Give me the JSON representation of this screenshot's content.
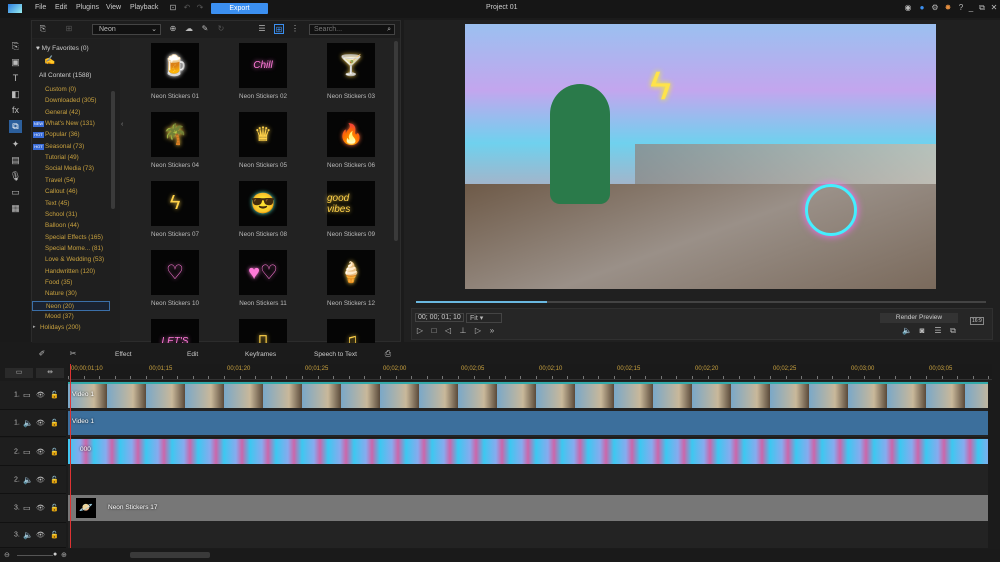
{
  "topbar": {
    "menus": [
      "File",
      "Edit",
      "Plugins",
      "View",
      "Playback"
    ],
    "export_label": "Export",
    "title": "Project 01"
  },
  "library": {
    "category_selected": "Neon",
    "search_placeholder": "Search...",
    "favorites": "My Favorites (0)",
    "all_content": "All Content (1588)",
    "categories": [
      {
        "label": "Custom  (0)"
      },
      {
        "label": "Downloaded  (305)"
      },
      {
        "label": "General  (42)"
      },
      {
        "label": "What's New  (131)",
        "badge": "NEW"
      },
      {
        "label": "Popular  (36)",
        "badge": "HOT"
      },
      {
        "label": "Seasonal  (73)",
        "badge": "HOT"
      },
      {
        "label": "Tutorial  (49)"
      },
      {
        "label": "Social Media  (73)"
      },
      {
        "label": "Travel  (54)"
      },
      {
        "label": "Callout  (46)"
      },
      {
        "label": "Text  (45)"
      },
      {
        "label": "School  (31)"
      },
      {
        "label": "Balloon  (44)"
      },
      {
        "label": "Special Effects  (165)"
      },
      {
        "label": "Special Mome...  (81)"
      },
      {
        "label": "Love & Wedding  (53)"
      },
      {
        "label": "Handwritten  (120)"
      },
      {
        "label": "Food  (35)"
      },
      {
        "label": "Nature  (30)"
      },
      {
        "label": "Neon  (20)",
        "selected": true
      },
      {
        "label": "Mood  (37)"
      },
      {
        "label": "Holidays  (200)",
        "expand": true
      }
    ],
    "stickers": [
      {
        "label": "Neon Stickers 01",
        "glyph": "🍺",
        "color": "#ffffff"
      },
      {
        "label": "Neon Stickers 02",
        "glyph": "Chill",
        "color": "#ff7ad9"
      },
      {
        "label": "Neon Stickers 03",
        "glyph": "🍸",
        "color": "#ffd24a"
      },
      {
        "label": "Neon Stickers 04",
        "glyph": "🌴",
        "color": "#ffd24a"
      },
      {
        "label": "Neon Stickers 05",
        "glyph": "♛",
        "color": "#ffd24a"
      },
      {
        "label": "Neon Stickers 06",
        "glyph": "🔥",
        "color": "#ff6a3a"
      },
      {
        "label": "Neon Stickers 07",
        "glyph": "ϟ",
        "color": "#ffd24a"
      },
      {
        "label": "Neon Stickers 08",
        "glyph": "😎",
        "color": "#5cf0d0"
      },
      {
        "label": "Neon Stickers 09",
        "glyph": "good vibes",
        "color": "#ffd24a"
      },
      {
        "label": "Neon Stickers 10",
        "glyph": "♡",
        "color": "#ff7ad9"
      },
      {
        "label": "Neon Stickers 11",
        "glyph": "♥♡",
        "color": "#ff7ad9"
      },
      {
        "label": "Neon Stickers 12",
        "glyph": "🍦",
        "color": "#ffd24a"
      },
      {
        "label": "",
        "glyph": "LET'S",
        "color": "#ff7ad9"
      },
      {
        "label": "",
        "glyph": "▯",
        "color": "#ffd24a"
      },
      {
        "label": "",
        "glyph": "♫",
        "color": "#ffd24a"
      }
    ]
  },
  "preview": {
    "timecode": "00; 00; 01; 10",
    "zoom": "Fit",
    "render_label": "Render Preview",
    "aspect": "16:9",
    "progress": 0.23
  },
  "timeline": {
    "tools": [
      "Effect",
      "Edit",
      "Keyframes",
      "Speech to Text"
    ],
    "ruler": [
      "00;00;01;10",
      "00;01;15",
      "00;01;20",
      "00;01;25",
      "00;02;00",
      "00;02;05",
      "00;02;10",
      "00;02;15",
      "00;02;20",
      "00;02;25",
      "00;03;00",
      "00;03;05"
    ],
    "tracks": [
      {
        "num": "1.",
        "type": "video",
        "clip": "Video 1"
      },
      {
        "num": "1.",
        "type": "audio",
        "clip": "Video 1"
      },
      {
        "num": "2.",
        "type": "video",
        "clip": "000"
      },
      {
        "num": "2.",
        "type": "audio",
        "clip": ""
      },
      {
        "num": "3.",
        "type": "video",
        "clip": "Neon Stickers 17"
      },
      {
        "num": "3.",
        "type": "audio",
        "clip": ""
      }
    ]
  },
  "colors": {
    "accent": "#3b8ff0",
    "gold": "#c9a23f"
  }
}
